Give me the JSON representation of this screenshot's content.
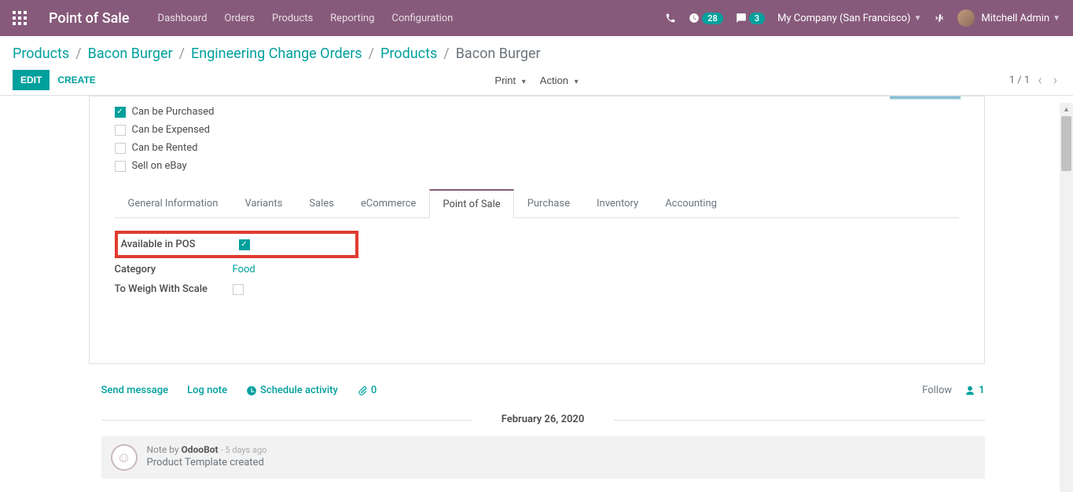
{
  "navbar": {
    "brand": "Point of Sale",
    "menu": [
      "Dashboard",
      "Orders",
      "Products",
      "Reporting",
      "Configuration"
    ],
    "activity_count": "28",
    "msg_count": "3",
    "company": "My Company (San Francisco)",
    "user": "Mitchell Admin"
  },
  "breadcrumb": {
    "items": [
      "Products",
      "Bacon Burger",
      "Engineering Change Orders",
      "Products"
    ],
    "current": "Bacon Burger"
  },
  "toolbar": {
    "edit": "EDIT",
    "create": "CREATE",
    "print": "Print",
    "action": "Action",
    "pager": "1 / 1"
  },
  "checks": {
    "purchased": "Can be Purchased",
    "expensed": "Can be Expensed",
    "rented": "Can be Rented",
    "ebay": "Sell on eBay"
  },
  "tabs": [
    "General Information",
    "Variants",
    "Sales",
    "eCommerce",
    "Point of Sale",
    "Purchase",
    "Inventory",
    "Accounting"
  ],
  "pos": {
    "available_label": "Available in POS",
    "category_label": "Category",
    "category_value": "Food",
    "weigh_label": "To Weigh With Scale"
  },
  "chatter": {
    "send": "Send message",
    "log": "Log note",
    "schedule": "Schedule activity",
    "attach_count": "0",
    "follow": "Follow",
    "followers": "1",
    "date": "February 26, 2020",
    "note_prefix": "Note by ",
    "author": "OdooBot",
    "ago": "- 5 days ago",
    "content": "Product Template created"
  }
}
